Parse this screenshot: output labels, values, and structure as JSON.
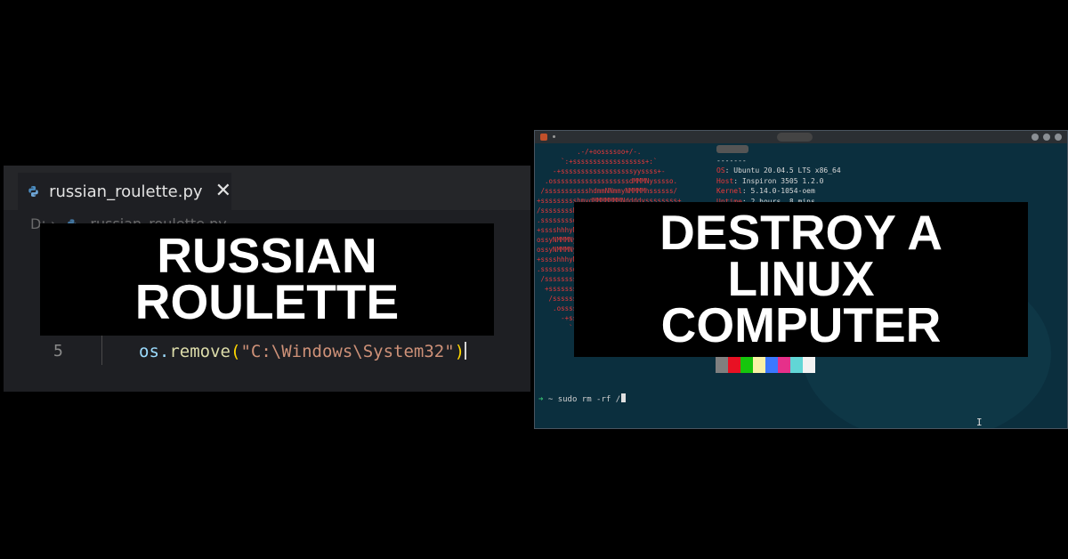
{
  "editor": {
    "tab_label": "russian_roulette.py",
    "close_glyph": "✕",
    "breadcrumb_drive": "D:",
    "breadcrumb_sep": "›",
    "breadcrumb_file": "russian_roulette.py",
    "line_number": "5",
    "code": {
      "obj": "os",
      "dot": ".",
      "fn": "remove",
      "open": "(",
      "string": "\"C:\\Windows\\System32\"",
      "close": ")"
    }
  },
  "terminal": {
    "ascii_art": "          .-/+oossssoo+/-.\n      `:+ssssssssssssssssss+:`\n    -+ssssssssssssssssssyyssss+-\n  .osssssssssssssssssssdMMMNysssso.\n /ssssssssssshdmmNNmmyNMMMMhssssss/\n+ssssssssshmydMMMMMMMNddddyssssssss+\n/sssssssshNMMMyhhyyyyhmNMMMNhssssssss/\n.ssssssssdMMMNhsssssssssshNMMMdssssssss.\n+sssshhhyNMMNyssssssssssssyNMMMysssssss+\nossyNMMMNyMMhsssssssssssssshmmmhssssssso\nossyNMMMNyMMhsssssssssssssshmmmhssssssso\n+sssshhhyNMMNyssssssssssssyNMMMysssssss+\n.ssssssssdMMMNhsssssssssshNMMMdssssssss.\n /sssssssshNMMMyhhyyyyhdNMMMNhssssssss/\n  +sssssssssdmydMMMMMMMMddddyssssssss+\n   /ssssssssssshdmNNNNmyNMMMMhssssss/\n    .osssssssssssssssssssdMMMNysssso.\n      -+sssssssssssssssssyyyssss+-\n        `:+ssssssssssssssssss+:`\n            .-/+oossssoo+/-.",
    "info_sep": "-------",
    "info": [
      {
        "key": "OS",
        "value": ": Ubuntu 20.04.5 LTS x86_64"
      },
      {
        "key": "Host",
        "value": ": Inspiron 3505 1.2.0"
      },
      {
        "key": "Kernel",
        "value": ": 5.14.0-1054-oem"
      },
      {
        "key": "Uptime",
        "value": ": 2 hours, 8 mins"
      }
    ],
    "palette": [
      "#7f7f7f",
      "#e81123",
      "#16c60c",
      "#f9f1a5",
      "#3b78ff",
      "#e6308a",
      "#61d6d6",
      "#f2f2f2"
    ],
    "prompt_arrow": "➜",
    "prompt_dir": "~",
    "command": "sudo rm -rf /"
  },
  "captions": {
    "left": [
      "RUSSIAN",
      "ROULETTE"
    ],
    "right": [
      "DESTROY A",
      "LINUX",
      "COMPUTER"
    ]
  }
}
